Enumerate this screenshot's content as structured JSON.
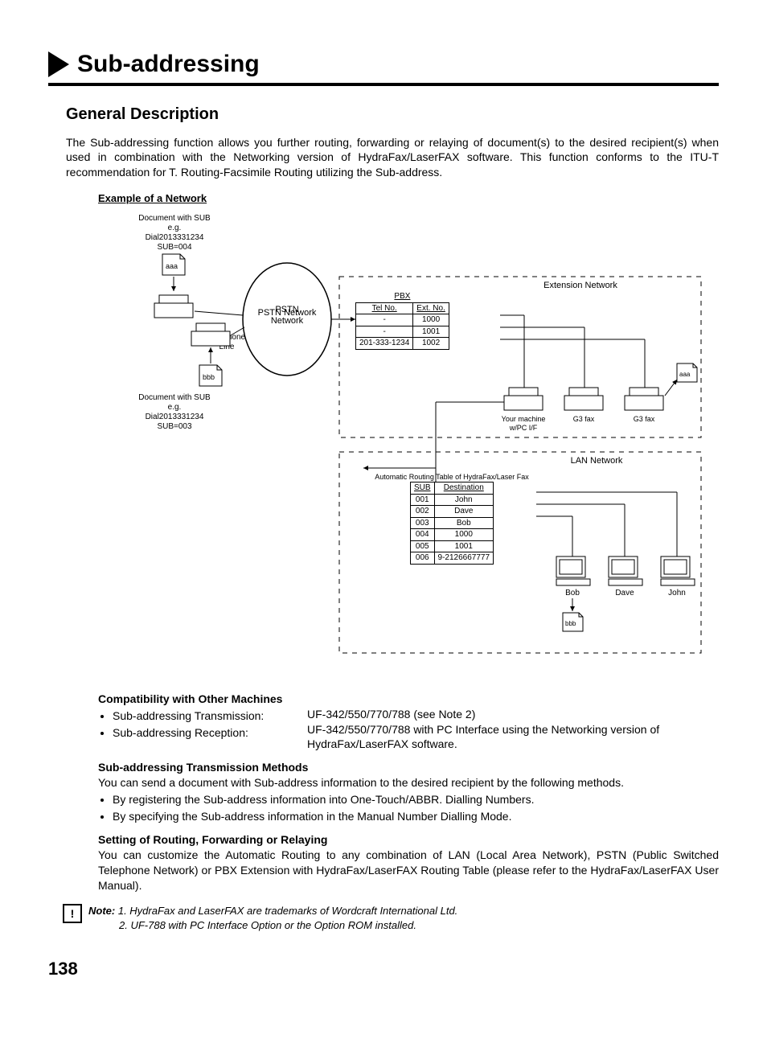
{
  "title": "Sub-addressing",
  "section": "General Description",
  "intro": "The Sub-addressing function allows you further routing, forwarding or relaying of document(s) to the desired recipient(s) when used in combination with the Networking version of HydraFax/LaserFAX software. This function conforms to the ITU-T recommendation for T. Routing-Facsimile Routing utilizing the Sub-address.",
  "example_header": "Example of a Network",
  "diagram": {
    "doc_a": {
      "label": "Document with SUB",
      "eg": "e.g.",
      "dial": "Dial2013331234",
      "sub": "SUB=004",
      "doc": "aaa"
    },
    "doc_b": {
      "label": "Document with SUB",
      "eg": "e.g.",
      "dial": "Dial2013331234",
      "sub": "SUB=003",
      "doc": "bbb"
    },
    "pstn": "PSTN Network",
    "tel_line": "Telephone Line",
    "ext_network": "Extension Network",
    "lan_network": "LAN Network",
    "pbx_table": {
      "title": "PBX",
      "headers": [
        "Tel No.",
        "Ext. No."
      ],
      "rows": [
        [
          "-",
          "1000"
        ],
        [
          "-",
          "1001"
        ],
        [
          "201-333-1234",
          "1002"
        ]
      ]
    },
    "machines": {
      "your": "Your machine w/PC I/F",
      "g3a": "G3 fax",
      "g3b": "G3 fax",
      "doc_out_a": "aaa"
    },
    "routing_table": {
      "title": "Automatic Routing Table of HydraFax/Laser Fax",
      "headers": [
        "SUB",
        "Destination"
      ],
      "rows": [
        [
          "001",
          "John"
        ],
        [
          "002",
          "Dave"
        ],
        [
          "003",
          "Bob"
        ],
        [
          "004",
          "1000"
        ],
        [
          "005",
          "1001"
        ],
        [
          "006",
          "9-2126667777"
        ]
      ]
    },
    "pcs": {
      "bob": "Bob",
      "dave": "Dave",
      "john": "John",
      "doc_out_b": "bbb"
    }
  },
  "compat": {
    "header": "Compatibility with Other Machines",
    "tx_label": "Sub-addressing Transmission:",
    "tx_value": "UF-342/550/770/788 (see Note 2)",
    "rx_label": "Sub-addressing Reception:",
    "rx_value": "UF-342/550/770/788 with PC Interface using the Networking version of HydraFax/LaserFAX software."
  },
  "methods": {
    "header": "Sub-addressing Transmission Methods",
    "intro": "You can send a document with Sub-address information to the desired recipient by the following methods.",
    "b1": "By registering the Sub-address information into One-Touch/ABBR. Dialling Numbers.",
    "b2": "By specifying the Sub-address information in the Manual Number Dialling Mode."
  },
  "routing": {
    "header": "Setting of Routing, Forwarding or Relaying",
    "body": "You can customize the Automatic Routing to any combination of LAN (Local Area Network), PSTN (Public Switched Telephone Network) or PBX Extension with HydraFax/LaserFAX Routing Table (please refer to the HydraFax/LaserFAX User Manual)."
  },
  "notes": {
    "label": "Note:",
    "n1": "1. HydraFax and LaserFAX are trademarks of Wordcraft International Ltd.",
    "n2": "2. UF-788 with PC Interface Option or the Option ROM installed."
  },
  "page": "138"
}
